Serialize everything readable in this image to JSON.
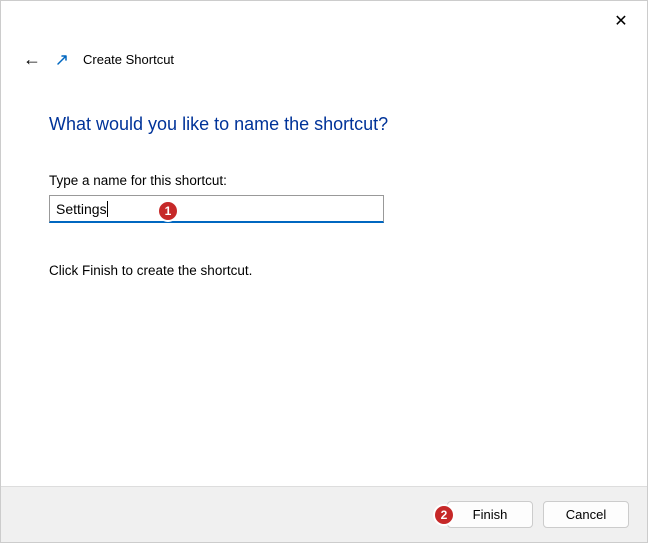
{
  "titlebar": {
    "close_symbol": "✕"
  },
  "header": {
    "back_symbol": "←",
    "wizard_title": "Create Shortcut"
  },
  "content": {
    "heading": "What would you like to name the shortcut?",
    "field_label": "Type a name for this shortcut:",
    "input_value": "Settings",
    "help_text": "Click Finish to create the shortcut."
  },
  "footer": {
    "finish_label": "Finish",
    "cancel_label": "Cancel"
  },
  "annotations": {
    "marker1": "1",
    "marker2": "2"
  }
}
